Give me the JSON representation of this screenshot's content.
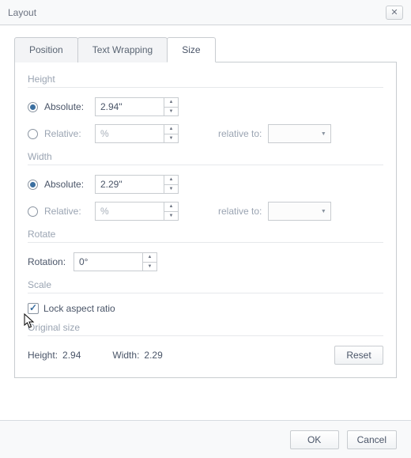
{
  "title": "Layout",
  "tabs": {
    "position": "Position",
    "wrapping": "Text Wrapping",
    "size": "Size"
  },
  "height": {
    "title": "Height",
    "absolute_label": "Absolute:",
    "absolute_value": "2.94\"",
    "relative_label": "Relative:",
    "relative_value": "%",
    "relative_to_label": "relative to:"
  },
  "width": {
    "title": "Width",
    "absolute_label": "Absolute:",
    "absolute_value": "2.29\"",
    "relative_label": "Relative:",
    "relative_value": "%",
    "relative_to_label": "relative to:"
  },
  "rotate": {
    "title": "Rotate",
    "rotation_label": "Rotation:",
    "rotation_value": "0°"
  },
  "scale": {
    "title": "Scale",
    "lock_label": "Lock aspect ratio"
  },
  "original": {
    "title": "Original size",
    "height_label": "Height:",
    "height_value": "2.94",
    "width_label": "Width:",
    "width_value": "2.29",
    "reset_label": "Reset"
  },
  "buttons": {
    "ok": "OK",
    "cancel": "Cancel"
  }
}
